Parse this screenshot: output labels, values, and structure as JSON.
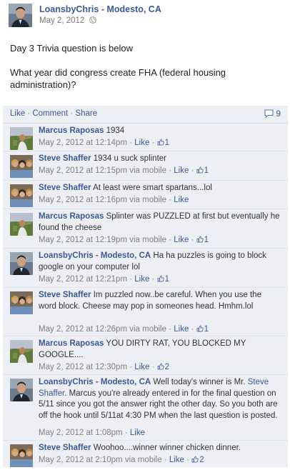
{
  "post": {
    "author": "LoansbyChris - Modesto, CA",
    "date": "May 2, 2012",
    "body_line1": "Day 3 Trivia question is below",
    "body_line2": "What year did congress create FHA (federal housing administration)?"
  },
  "actions": {
    "like": "Like",
    "comment": "Comment",
    "share": "Share",
    "separator": "·",
    "comment_count": "9"
  },
  "comments": [
    {
      "name": "Marcus Raposas",
      "text": "1934",
      "time": "May 2, 2012 at 12:14pm",
      "via": "",
      "like": "Like",
      "likes": "1"
    },
    {
      "name": "Steve Shaffer",
      "text": "1934 u suck splinter",
      "time": "May 2, 2012 at 12:15pm",
      "via": "via mobile",
      "like": "Like",
      "likes": "1"
    },
    {
      "name": "Steve Shaffer",
      "text": "At least were smart spartans...lol",
      "time": "May 2, 2012 at 12:16pm",
      "via": "via mobile",
      "like": "Like",
      "likes": ""
    },
    {
      "name": "Marcus Raposas",
      "text": "Splinter was PUZZLED at first but eventually he found the cheese",
      "time": "May 2, 2012 at 12:19pm",
      "via": "via mobile",
      "like": "Like",
      "likes": "1"
    },
    {
      "name": "LoansbyChris - Modesto, CA",
      "text": "Ha ha puzzles is going to block google on your computer lol",
      "time": "May 2, 2012 at 12:21pm",
      "via": "",
      "like": "Like",
      "likes": "1"
    },
    {
      "name": "Steve Shaffer",
      "text": "Im puzzled now..be careful. When you use the word block. Cheese may pop in someones head. Hmhm.lol",
      "time": "May 2, 2012 at 12:26pm",
      "via": "via mobile",
      "like": "Like",
      "likes": "1"
    },
    {
      "name": "Marcus Raposas",
      "text": "YOU DIRTY RAT, YOU BLOCKED MY GOOGLE....",
      "time": "May 2, 2012 at 12:30pm",
      "via": "",
      "like": "Like",
      "likes": "2"
    },
    {
      "name": "LoansbyChris - Modesto, CA",
      "text_before": "Well today's winner is Mr.",
      "mention": "Steve Shaffer",
      "text_after": ". Marcus you're already entered in for the final question on 5/11 since you got the answer right the other day. So you both are off the hook until 5/11at 4:30 PM when the last question is posted.",
      "time": "May 2, 2012 at 1:08pm",
      "via": "",
      "like": "Like",
      "likes": ""
    },
    {
      "name": "Steve Shaffer",
      "text": "Woohoo....winner winner chicken dinner.",
      "time": "May 2, 2012 at 2:10pm",
      "via": "via mobile",
      "like": "Like",
      "likes": "2"
    }
  ]
}
